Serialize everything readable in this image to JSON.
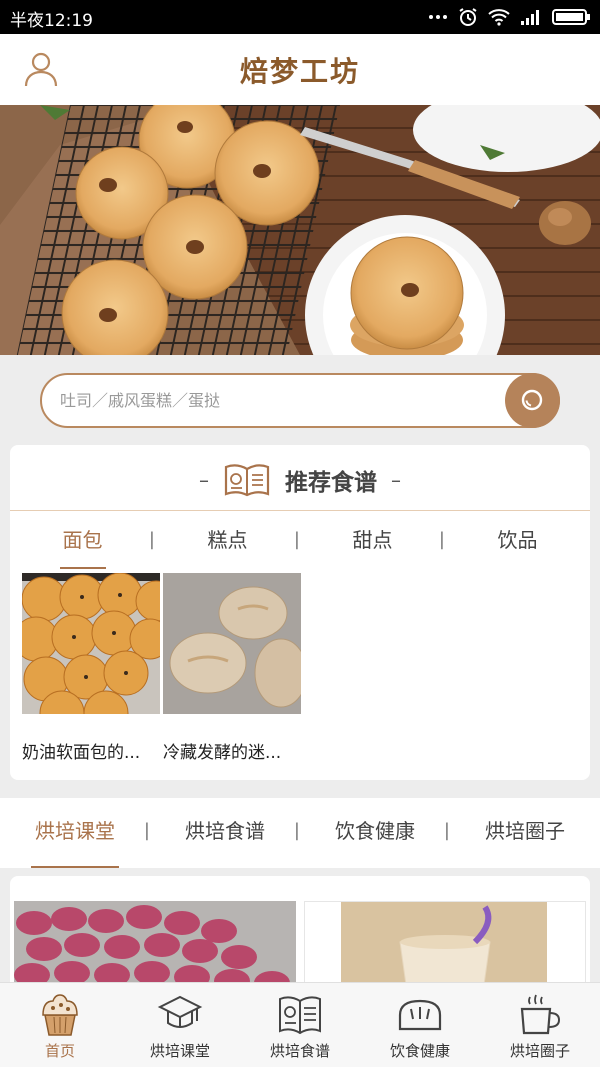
{
  "status_bar": {
    "time": "半夜12:19"
  },
  "header": {
    "title": "焙梦工坊"
  },
  "search": {
    "placeholder": "吐司／戚风蛋糕／蛋挞"
  },
  "recommend": {
    "title": "推荐食谱",
    "dash_left": "–",
    "dash_right": "–",
    "tabs": [
      "面包",
      "糕点",
      "甜点",
      "饮品"
    ],
    "separator": "|",
    "items": [
      {
        "caption": "奶油软面包的..."
      },
      {
        "caption": "冷藏发酵的迷..."
      }
    ]
  },
  "categories": [
    "烘培课堂",
    "烘培食谱",
    "饮食健康",
    "烘培圈子"
  ],
  "tabbar": [
    {
      "label": "首页",
      "icon": "cupcake-icon"
    },
    {
      "label": "烘培课堂",
      "icon": "graduation-cap-icon"
    },
    {
      "label": "烘培食谱",
      "icon": "recipe-book-icon"
    },
    {
      "label": "饮食健康",
      "icon": "bread-loaf-icon"
    },
    {
      "label": "烘培圈子",
      "icon": "coffee-cup-icon"
    }
  ],
  "colors": {
    "accent": "#a9734b",
    "title": "#8b5a2b",
    "search_button": "#b5835a"
  }
}
